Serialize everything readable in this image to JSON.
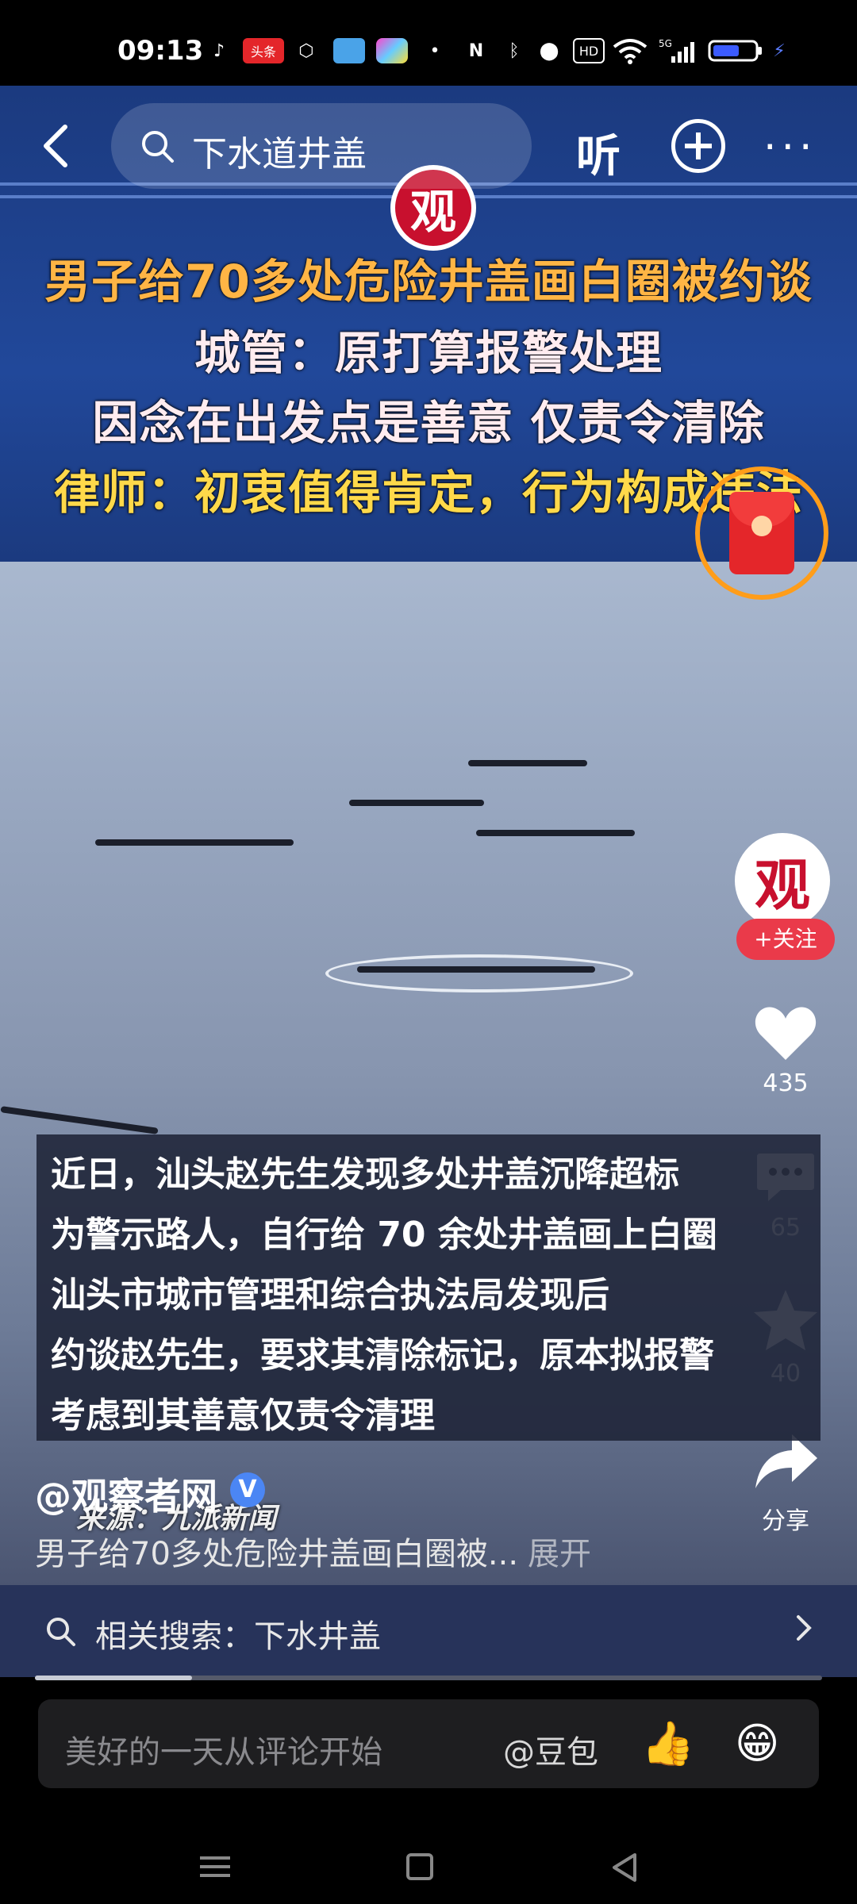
{
  "status_bar": {
    "time": "09:13",
    "icons": [
      "tiktok-icon",
      "toutiao-icon",
      "cube-icon",
      "wallet-icon",
      "photos-icon",
      "dot-icon",
      "nfc-icon",
      "bluetooth-icon",
      "location-icon",
      "hd-icon",
      "wifi-icon",
      "5g-signal-icon",
      "battery-icon",
      "charging-icon"
    ],
    "toutiao_label": "头条",
    "hd_label": "HD",
    "network_label": "5G"
  },
  "top_nav": {
    "search_text": "下水道井盖",
    "listen_label": "听"
  },
  "video": {
    "logo_char": "观",
    "headline_lines": [
      "男子给70多处危险井盖画白圈被约谈",
      "城管：原打算报警处理",
      "因念在出发点是善意 仅责令清除",
      "律师：初衷值得肯定，行为构成违法"
    ],
    "caption_lines": [
      "近日，汕头赵先生发现多处井盖沉降超标",
      "为警示路人，自行给 70 余处井盖画上白圈",
      "汕头市城市管理和综合执法局发现后",
      "约谈赵先生，要求其清除标记，原本拟报警",
      "考虑到其善意仅责令清理"
    ],
    "source": "来源：九派新闻"
  },
  "right_rail": {
    "avatar_char": "观",
    "follow_label": "+关注",
    "like_count": "435",
    "comment_count": "65",
    "favorite_count": "40",
    "share_label": "分享"
  },
  "post": {
    "author": "@观察者网",
    "verified_label": "V",
    "description": "男子给70多处危险井盖画白圈被...",
    "expand_label": "展开"
  },
  "related_search": {
    "text": "相关搜索：下水井盖"
  },
  "playback_progress": 0.2,
  "comment_bar": {
    "placeholder": "美好的一天从评论开始",
    "at_label": "@豆包",
    "thumb_emoji": "👍",
    "grin_emoji": "😁"
  },
  "colors": {
    "accent_red": "#ea3a4a",
    "banner_blue": "#21489a",
    "headline_orange": "#ffb545",
    "headline_yellow": "#ffd94a",
    "red_packet_ring": "#ff9d1a"
  }
}
